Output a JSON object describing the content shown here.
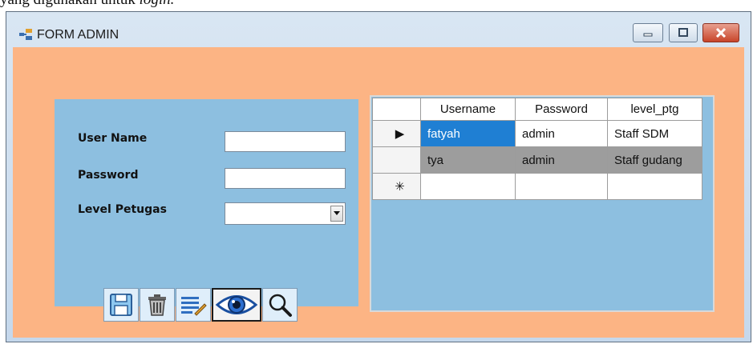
{
  "doc_text": {
    "prefix": "yang digunakan untuk ",
    "italic": "login."
  },
  "window": {
    "title": "FORM ADMIN",
    "buttons": {
      "minimize": "minimize",
      "maximize": "maximize",
      "close": "close"
    }
  },
  "form": {
    "user_name_label": "User Name",
    "password_label": "Password",
    "level_label": "Level Petugas",
    "user_name_value": "",
    "password_value": "",
    "level_value": ""
  },
  "toolbar": {
    "icons": [
      "save-icon",
      "delete-icon",
      "edit-icon",
      "view-icon",
      "search-icon"
    ]
  },
  "grid": {
    "columns": [
      "Username",
      "Password",
      "level_ptg"
    ],
    "rows": [
      {
        "marker": "▶",
        "username": "fatyah",
        "password": "admin",
        "level": "Staff SDM"
      },
      {
        "marker": "",
        "username": "tya",
        "password": "admin",
        "level": "Staff gudang"
      },
      {
        "marker": "✳",
        "username": "",
        "password": "",
        "level": ""
      }
    ]
  },
  "colors": {
    "form_background": "#fcb484",
    "panel_background": "#8dbfe0",
    "selected_cell": "#1f7fd3",
    "alt_row": "#9d9d9d"
  }
}
